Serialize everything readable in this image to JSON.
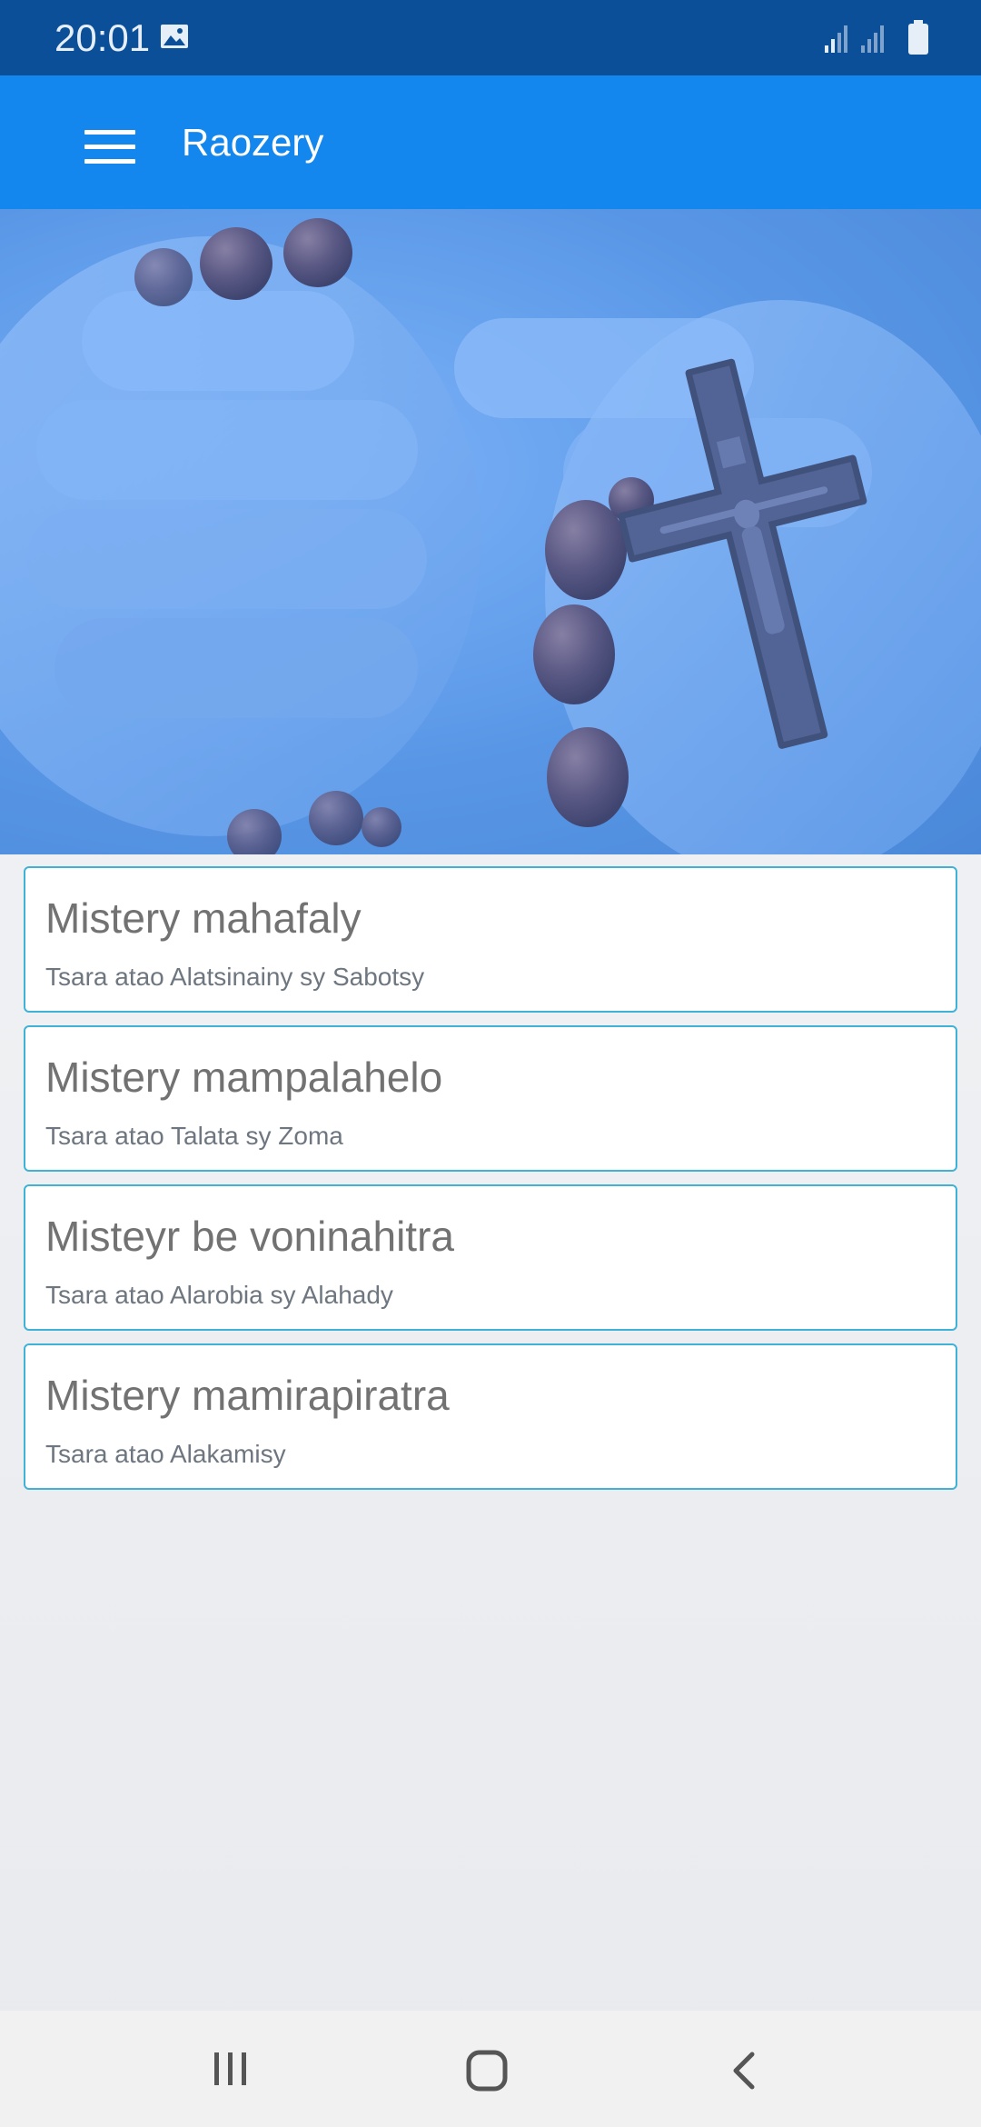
{
  "status_bar": {
    "time": "20:01",
    "icons": [
      "gallery-icon",
      "signal-icon",
      "signal-icon",
      "battery-icon"
    ],
    "background": "#0a4f98"
  },
  "app_bar": {
    "title": "Raozery",
    "menu_icon": "hamburger-menu-icon",
    "background": "#1387ee"
  },
  "hero": {
    "description_icon": "rosary-crucifix-image"
  },
  "mysteries": [
    {
      "title": "Mistery mahafaly",
      "subtitle": "Tsara atao Alatsinainy sy Sabotsy"
    },
    {
      "title": "Mistery mampalahelo",
      "subtitle": "Tsara atao Talata sy Zoma"
    },
    {
      "title": "Misteyr be voninahitra",
      "subtitle": "Tsara atao Alarobia sy Alahady"
    },
    {
      "title": "Mistery mamirapiratra",
      "subtitle": "Tsara atao Alakamisy"
    }
  ],
  "nav_bar": {
    "icons": [
      "recent-apps-icon",
      "home-icon",
      "back-icon"
    ]
  },
  "colors": {
    "card_border": "#3fb2d6",
    "card_title": "#727272",
    "card_subtitle": "#6e7680"
  }
}
